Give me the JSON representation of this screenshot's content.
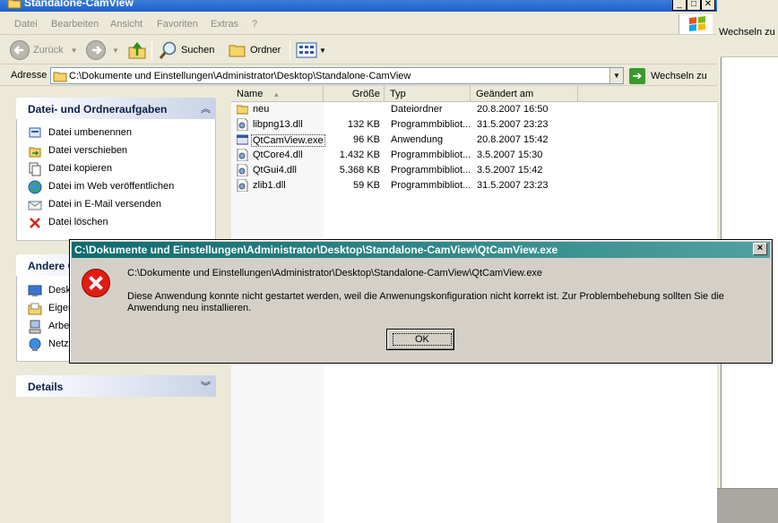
{
  "window": {
    "title": "Standalone-CamView",
    "menu": [
      "Datei",
      "Bearbeiten",
      "Ansicht",
      "Favoriten",
      "Extras",
      "?"
    ],
    "toolbar": {
      "back": "Zurück",
      "search": "Suchen",
      "folders": "Ordner"
    },
    "address": {
      "label": "Adresse",
      "path": "C:\\Dokumente und Einstellungen\\Administrator\\Desktop\\Standalone-CamView",
      "go": "Wechseln zu"
    }
  },
  "task_pane": {
    "file_tasks": {
      "title": "Datei- und Ordneraufgaben",
      "items": [
        {
          "label": "Datei umbenennen",
          "icon": "rename-icon"
        },
        {
          "label": "Datei verschieben",
          "icon": "move-icon"
        },
        {
          "label": "Datei kopieren",
          "icon": "copy-icon"
        },
        {
          "label": "Datei im Web veröffentlichen",
          "icon": "web-publish-icon"
        },
        {
          "label": "Datei in E-Mail versenden",
          "icon": "email-icon"
        },
        {
          "label": "Datei löschen",
          "icon": "delete-icon"
        }
      ]
    },
    "other_places": {
      "title": "Andere O",
      "items": [
        {
          "label": "Desk",
          "icon": "desktop-icon"
        },
        {
          "label": "Eigen",
          "icon": "my-documents-icon"
        },
        {
          "label": "Arbe",
          "icon": "my-computer-icon"
        },
        {
          "label": "Netz",
          "icon": "network-icon"
        }
      ]
    },
    "details": {
      "title": "Details"
    }
  },
  "file_list": {
    "columns": {
      "name": "Name",
      "size": "Größe",
      "type": "Typ",
      "modified": "Geändert am"
    },
    "files": [
      {
        "name": "neu",
        "size": "",
        "type": "Dateiordner",
        "modified": "20.8.2007 16:50",
        "icon": "folder-icon"
      },
      {
        "name": "libpng13.dll",
        "size": "132 KB",
        "type": "Programmbibliot...",
        "modified": "31.5.2007 23:23",
        "icon": "dll-icon"
      },
      {
        "name": "QtCamView.exe",
        "size": "96 KB",
        "type": "Anwendung",
        "modified": "20.8.2007 15:42",
        "icon": "exe-icon"
      },
      {
        "name": "QtCore4.dll",
        "size": "1.432 KB",
        "type": "Programmbibliot...",
        "modified": "3.5.2007 15:30",
        "icon": "dll-icon"
      },
      {
        "name": "QtGui4.dll",
        "size": "5.368 KB",
        "type": "Programmbibliot...",
        "modified": "3.5.2007 15:42",
        "icon": "dll-icon"
      },
      {
        "name": "zlib1.dll",
        "size": "59 KB",
        "type": "Programmbibliot...",
        "modified": "31.5.2007 23:23",
        "icon": "dll-icon"
      }
    ]
  },
  "background_window": {
    "go": "Wechseln zu"
  },
  "dialog": {
    "title": "C:\\Dokumente und Einstellungen\\Administrator\\Desktop\\Standalone-CamView\\QtCamView.exe",
    "path": "C:\\Dokumente und Einstellungen\\Administrator\\Desktop\\Standalone-CamView\\QtCamView.exe",
    "message": "Diese Anwendung konnte nicht gestartet werden, weil die Anwenungskonfiguration nicht korrekt ist. Zur Problembehebung sollten Sie die Anwendung neu installieren.",
    "ok": "OK",
    "close": "×",
    "icon": "error-icon"
  }
}
